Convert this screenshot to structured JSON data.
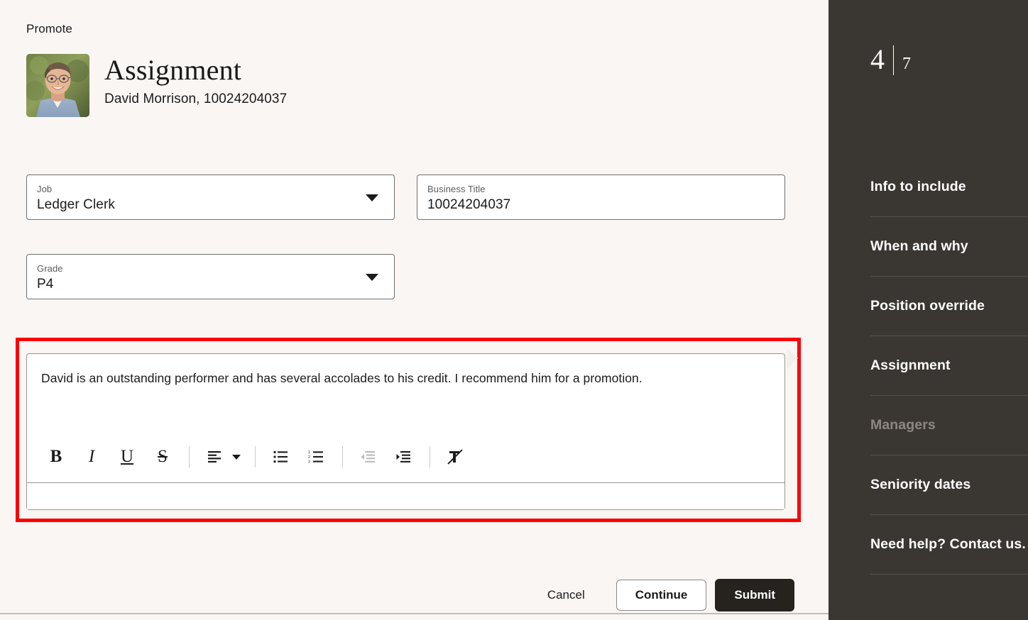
{
  "header": {
    "eyebrow": "Promote",
    "title": "Assignment",
    "subtitle": "David Morrison, 10024204037",
    "avatar_alt": "employee-photo"
  },
  "form": {
    "job": {
      "label": "Job",
      "value": "Ledger Clerk"
    },
    "business_title": {
      "label": "Business Title",
      "value": "10024204037"
    },
    "grade": {
      "label": "Grade",
      "value": "P4"
    }
  },
  "editor": {
    "content": "David is an outstanding performer and has several accolades to his credit. I recommend him for a promotion.",
    "highlight_color": "#ff0000",
    "toolbar": [
      {
        "name": "bold-icon",
        "label": "B",
        "disabled": false
      },
      {
        "name": "italic-icon",
        "label": "I",
        "disabled": false
      },
      {
        "name": "underline-icon",
        "label": "U",
        "disabled": false
      },
      {
        "name": "strikethrough-icon",
        "label": "S",
        "disabled": false
      },
      {
        "name": "align-left-icon",
        "label": "Align",
        "disabled": false
      },
      {
        "name": "bulleted-list-icon",
        "label": "Bulleted list",
        "disabled": false
      },
      {
        "name": "numbered-list-icon",
        "label": "Numbered list",
        "disabled": false
      },
      {
        "name": "outdent-icon",
        "label": "Decrease indent",
        "disabled": true
      },
      {
        "name": "indent-icon",
        "label": "Increase indent",
        "disabled": false
      },
      {
        "name": "clear-formatting-icon",
        "label": "Clear formatting",
        "disabled": false
      }
    ]
  },
  "actions": {
    "cancel": "Cancel",
    "continue": "Continue",
    "submit": "Submit"
  },
  "sidebar": {
    "background": "#3a3632",
    "step_current": "4",
    "step_total": "7",
    "items": [
      {
        "label": "Info to include",
        "state": "done"
      },
      {
        "label": "When and why",
        "state": "done"
      },
      {
        "label": "Position override",
        "state": "done"
      },
      {
        "label": "Assignment",
        "state": "active"
      },
      {
        "label": "Managers",
        "state": "disabled"
      },
      {
        "label": "Seniority dates",
        "state": "done"
      },
      {
        "label": "Need help? Contact us.",
        "state": "done"
      }
    ]
  }
}
